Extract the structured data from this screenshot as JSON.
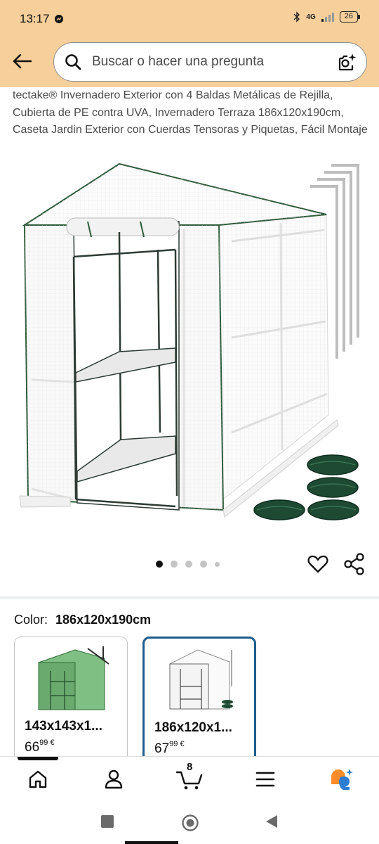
{
  "status_bar": {
    "time": "13:17",
    "network": "4G",
    "battery": "26"
  },
  "header": {
    "back_icon": "back-arrow-icon",
    "search_placeholder": "Buscar o hacer una pregunta",
    "search_icon": "search-icon",
    "camera_icon": "camera-lens-icon"
  },
  "product": {
    "title": "tectake® Invernadero Exterior con 4 Baldas Metálicas de Rejilla, Cubierta de PE contra UVA, Invernadero Terraza 186x120x190cm, Caseta Jardin Exterior con Cuerdas Tensoras y Piquetas, Fácil Montaje",
    "image_count": 5,
    "active_image": 1
  },
  "actions": {
    "favorite_icon": "heart-icon",
    "share_icon": "share-icon"
  },
  "color_selector": {
    "label": "Color:",
    "selected": "186x120x190cm"
  },
  "variants": [
    {
      "name": "143x143x1...",
      "price_whole": "66",
      "price_fraction": "99",
      "currency": "€",
      "selected": false,
      "accent": "#2e8b3a"
    },
    {
      "name": "186x120x1...",
      "price_whole": "67",
      "price_fraction": "99",
      "currency": "€",
      "selected": true,
      "accent": "#1f5d8c"
    }
  ],
  "bottom_nav": {
    "items": [
      "home-icon",
      "account-icon",
      "cart-icon",
      "menu-icon",
      "rufus-assistant-icon"
    ],
    "cart_count": "8"
  },
  "colors": {
    "header_bg": "#f7cf9b",
    "selected_border": "#1f5d8c",
    "assistant_orange": "#ff8c2b",
    "assistant_blue": "#2d7dd2"
  }
}
